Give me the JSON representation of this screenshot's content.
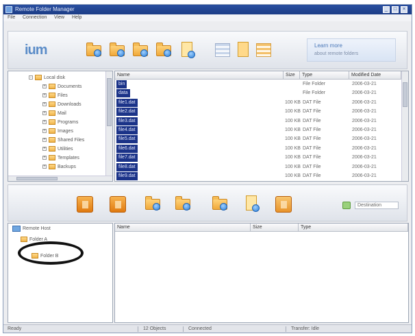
{
  "window": {
    "title": "Remote Folder Manager",
    "controls": [
      "_",
      "□",
      "×"
    ]
  },
  "menu": [
    "File",
    "Connection",
    "View",
    "Help"
  ],
  "toolbar_top": {
    "logo": "ium",
    "ad_line1": "Learn more",
    "ad_line2": "about remote folders"
  },
  "local": {
    "tree": [
      {
        "label": "Local disk",
        "level": 0,
        "expander": "-"
      },
      {
        "label": "Documents",
        "level": 1,
        "expander": "+"
      },
      {
        "label": "Files",
        "level": 1,
        "expander": "+"
      },
      {
        "label": "Downloads",
        "level": 1,
        "expander": "+"
      },
      {
        "label": "Mail",
        "level": 1,
        "expander": "+"
      },
      {
        "label": "Programs",
        "level": 1,
        "expander": "+"
      },
      {
        "label": "Images",
        "level": 1,
        "expander": "+"
      },
      {
        "label": "Shared Files",
        "level": 1,
        "expander": "+"
      },
      {
        "label": "Utilities",
        "level": 1,
        "expander": "+"
      },
      {
        "label": "Templates",
        "level": 1,
        "expander": "+"
      },
      {
        "label": "Backups",
        "level": 1,
        "expander": "+"
      }
    ],
    "columns": [
      "Name",
      "Size",
      "Type",
      "Modified Date"
    ],
    "files": [
      {
        "name": "bin",
        "size": "",
        "type": "File Folder",
        "date": "2006-03-21"
      },
      {
        "name": "data",
        "size": "",
        "type": "File Folder",
        "date": "2006-03-21"
      },
      {
        "name": "file1.dat",
        "size": "100 KB",
        "type": "DAT File",
        "date": "2006-03-21"
      },
      {
        "name": "file2.dat",
        "size": "100 KB",
        "type": "DAT File",
        "date": "2006-03-21"
      },
      {
        "name": "file3.dat",
        "size": "100 KB",
        "type": "DAT File",
        "date": "2006-03-21"
      },
      {
        "name": "file4.dat",
        "size": "100 KB",
        "type": "DAT File",
        "date": "2006-03-21"
      },
      {
        "name": "file5.dat",
        "size": "100 KB",
        "type": "DAT File",
        "date": "2006-03-21"
      },
      {
        "name": "file6.dat",
        "size": "100 KB",
        "type": "DAT File",
        "date": "2006-03-21"
      },
      {
        "name": "file7.dat",
        "size": "100 KB",
        "type": "DAT File",
        "date": "2006-03-21"
      },
      {
        "name": "file8.dat",
        "size": "100 KB",
        "type": "DAT File",
        "date": "2006-03-21"
      },
      {
        "name": "file9.dat",
        "size": "100 KB",
        "type": "DAT File",
        "date": "2006-03-21"
      }
    ]
  },
  "toolbar_mid": {
    "path_label": "Destination"
  },
  "remote": {
    "tree": [
      {
        "label": "Remote Host",
        "kind": "host"
      },
      {
        "label": "Folder A",
        "kind": "folder"
      },
      {
        "label": "Folder B",
        "kind": "folder"
      }
    ],
    "columns": [
      "Name",
      "Size",
      "Type"
    ]
  },
  "status": {
    "left": "Ready",
    "s1": "12 Objects",
    "s2": "Connected",
    "s3": "Transfer: Idle"
  },
  "colors": {
    "title_bar": "#1c3c86",
    "selection": "#1b3388",
    "folder": "#f0a83a",
    "annotation_circle": "#111111"
  }
}
